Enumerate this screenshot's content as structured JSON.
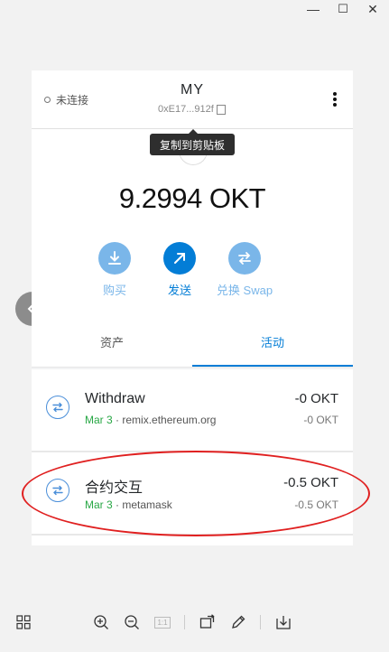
{
  "window": {
    "minimize": "—",
    "maximize": "☐",
    "close": "✕"
  },
  "header": {
    "status": "未连接",
    "account_name": "MY",
    "account_address": "0xE17...912f",
    "tooltip": "复制到剪贴板"
  },
  "balance": "9.2994 OKT",
  "actions": [
    {
      "label": "购买",
      "icon": "download-icon"
    },
    {
      "label": "发送",
      "icon": "send-arrow-icon"
    },
    {
      "label": "兑换 Swap",
      "icon": "swap-icon"
    }
  ],
  "tabs": [
    {
      "label": "资产",
      "active": false
    },
    {
      "label": "活动",
      "active": true
    }
  ],
  "transactions": [
    {
      "title": "Withdraw",
      "date": "Mar 3",
      "origin": "remix.ethereum.org",
      "amount": "-0 OKT",
      "amount_secondary": "-0 OKT"
    },
    {
      "title": "合约交互",
      "date": "Mar 3",
      "origin": "metamask",
      "amount": "-0.5 OKT",
      "amount_secondary": "-0.5 OKT"
    }
  ],
  "toolbar": {
    "actual_size": "1:1"
  },
  "colors": {
    "accent": "#037dd6",
    "accent_light": "#7ab6e9",
    "annotation": "#e02020",
    "positive_date": "#28a745"
  }
}
